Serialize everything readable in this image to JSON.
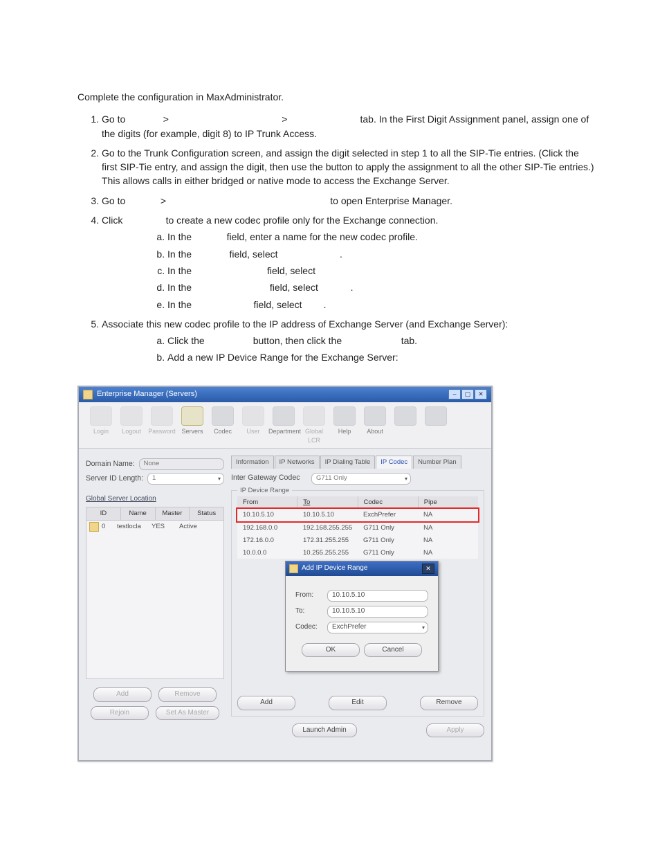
{
  "doc": {
    "intro": "Complete the configuration in MaxAdministrator.",
    "steps": [
      {
        "n": "1.",
        "pre": "Go to ",
        "sep1": ">",
        "sep2": ">",
        "tail": " tab. In the First Digit Assignment panel, assign one of the digits (for example, digit 8) to IP Trunk Access."
      },
      {
        "n": "2.",
        "text": "Go to the Trunk Configuration screen, and assign the digit selected in step 1 to all the SIP-Tie entries. (Click the first SIP-Tie entry, and assign the digit, then use the            button to apply the assignment to all the other SIP-Tie entries.) This allows calls in either bridged or native mode to access the Exchange Server."
      },
      {
        "n": "3.",
        "pre": "Go to ",
        "sep1": ">",
        "tail": " to open Enterprise Manager."
      },
      {
        "n": "4.",
        "pre": "Click ",
        "tail": " to create a new codec profile only for the Exchange connection.",
        "sub": [
          {
            "l": "a.",
            "pre": "In the ",
            "mid": " field, enter a name for the new codec profile."
          },
          {
            "l": "b.",
            "pre": "In the ",
            "mid": " field, select ",
            "post": "."
          },
          {
            "l": "c.",
            "pre": "In the ",
            "mid": " field, select"
          },
          {
            "l": "d.",
            "pre": "In the ",
            "mid": " field, select ",
            "post": "."
          },
          {
            "l": "e.",
            "pre": "In the ",
            "mid": " field, select ",
            "post": "."
          }
        ]
      },
      {
        "n": "5.",
        "text": "Associate this new codec profile to the IP address of Exchange Server (and         Exchange Server):",
        "sub": [
          {
            "l": "a.",
            "pre": "Click the ",
            "mid": " button, then click the ",
            "post": " tab."
          },
          {
            "l": "b.",
            "text": "Add a new IP Device Range for the Exchange Server:"
          }
        ]
      }
    ]
  },
  "app": {
    "title": "Enterprise Manager  (Servers)",
    "win": {
      "min": "–",
      "max": "▢",
      "close": "✕"
    },
    "toolbar": [
      {
        "name": "login",
        "label": "Login",
        "dis": true
      },
      {
        "name": "logout",
        "label": "Logout",
        "dis": true
      },
      {
        "name": "password",
        "label": "Password",
        "dis": true
      },
      {
        "name": "servers",
        "label": "Servers",
        "sel": true
      },
      {
        "name": "codec",
        "label": "Codec"
      },
      {
        "name": "user",
        "label": "User",
        "dis": true
      },
      {
        "name": "department",
        "label": "Department"
      },
      {
        "name": "globallcr",
        "label": "Global LCR",
        "dis": true
      },
      {
        "name": "help",
        "label": "Help"
      },
      {
        "name": "about",
        "label": "About"
      },
      {
        "name": "blank1",
        "label": ""
      },
      {
        "name": "blank2",
        "label": ""
      }
    ],
    "left": {
      "domain_label": "Domain Name:",
      "domain_value": "None",
      "serverid_label": "Server ID Length:",
      "serverid_value": "1",
      "gsl_label": "Global Server Location",
      "grid": {
        "head": [
          "ID",
          "Name",
          "Master",
          "Status"
        ],
        "row": {
          "id": "0",
          "name": "testlocla",
          "master": "YES",
          "status": "Active"
        }
      },
      "btns": {
        "add": "Add",
        "remove": "Remove",
        "rejoin": "Rejoin",
        "setmaster": "Set As Master"
      }
    },
    "right": {
      "tabs": [
        "Information",
        "IP Networks",
        "IP Dialing Table",
        "IP Codec",
        "Number Plan"
      ],
      "sel_tab": 3,
      "intergw_label": "Inter Gateway Codec",
      "intergw_value": "G711 Only",
      "range_title": "IP Device Range",
      "grid": {
        "head": [
          "From",
          "To",
          "Codec",
          "Pipe"
        ],
        "rows": [
          {
            "from": "10.10.5.10",
            "to": "10.10.5.10",
            "codec": "ExchPrefer",
            "pipe": "NA",
            "hl": true
          },
          {
            "from": "192.168.0.0",
            "to": "192.168.255.255",
            "codec": "G711 Only",
            "pipe": "NA",
            "top": true
          },
          {
            "from": "172.16.0.0",
            "to": "172.31.255.255",
            "codec": "G711 Only",
            "pipe": "NA"
          },
          {
            "from": "10.0.0.0",
            "to": "10.255.255.255",
            "codec": "G711 Only",
            "pipe": "NA"
          }
        ]
      },
      "btns": {
        "add": "Add",
        "edit": "Edit",
        "remove": "Remove",
        "launch": "Launch Admin",
        "apply": "Apply"
      }
    },
    "dialog": {
      "title": "Add IP Device Range",
      "from_label": "From:",
      "from_value": "10.10.5.10",
      "to_label": "To:",
      "to_value": "10.10.5.10",
      "codec_label": "Codec:",
      "codec_value": "ExchPrefer",
      "ok": "OK",
      "cancel": "Cancel",
      "close": "✕"
    }
  }
}
